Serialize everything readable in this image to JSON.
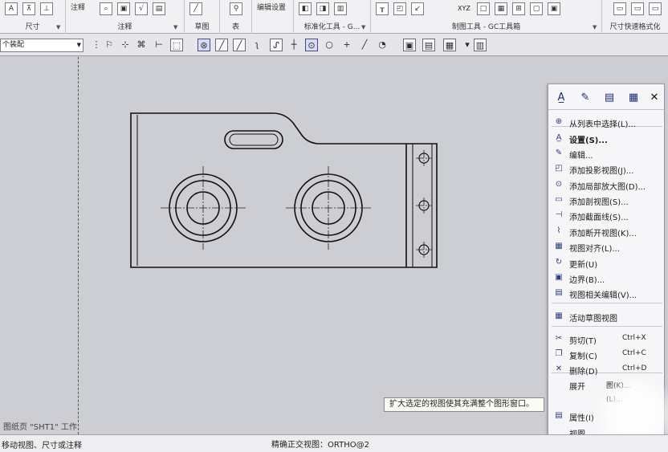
{
  "ribbon": {
    "groups": [
      {
        "top_label": "",
        "label": "尺寸"
      },
      {
        "top_label": "注释",
        "label": "注释"
      },
      {
        "top_label": "",
        "label": "草图"
      },
      {
        "top_label": "",
        "label": "表"
      },
      {
        "top_label": "编辑设置",
        "label": ""
      },
      {
        "top_label": "",
        "label": "标准化工具 - G..."
      },
      {
        "top_label": "",
        "label": "制图工具 - GC工具箱"
      },
      {
        "top_label": "",
        "label": "尺寸快速格式化"
      }
    ],
    "xyz_label": "XYZ"
  },
  "toolbar": {
    "filter_value": "个装配"
  },
  "canvas": {
    "sheet_label": "图纸页 \"SHT1\" 工作"
  },
  "context_menu": {
    "items": [
      {
        "icon": "list-select-icon",
        "label": "从列表中选择(L)...",
        "shortcut": ""
      },
      {
        "icon": "settings-icon",
        "label": "设置(S)...",
        "shortcut": "",
        "bold": true
      },
      {
        "icon": "edit-icon",
        "label": "编辑...",
        "shortcut": ""
      },
      {
        "icon": "projected-view-icon",
        "label": "添加投影视图(J)...",
        "shortcut": ""
      },
      {
        "icon": "detail-view-icon",
        "label": "添加局部放大图(D)...",
        "shortcut": ""
      },
      {
        "icon": "section-view-icon",
        "label": "添加剖视图(S)...",
        "shortcut": ""
      },
      {
        "icon": "section-line-icon",
        "label": "添加截面线(S)...",
        "shortcut": ""
      },
      {
        "icon": "break-view-icon",
        "label": "添加断开视图(K)...",
        "shortcut": ""
      },
      {
        "icon": "view-align-icon",
        "label": "视图对齐(L)...",
        "shortcut": ""
      },
      {
        "icon": "update-icon",
        "label": "更新(U)",
        "shortcut": ""
      },
      {
        "icon": "boundary-icon",
        "label": "边界(B)...",
        "shortcut": ""
      },
      {
        "icon": "view-dependent-edit-icon",
        "label": "视图相关编辑(V)...",
        "shortcut": ""
      },
      {
        "icon": "active-sketch-view-icon",
        "label": "活动草图视图",
        "shortcut": ""
      },
      {
        "icon": "cut-icon",
        "label": "剪切(T)",
        "shortcut": "Ctrl+X"
      },
      {
        "icon": "copy-icon",
        "label": "复制(C)",
        "shortcut": "Ctrl+C"
      },
      {
        "icon": "delete-icon",
        "label": "删除(D)",
        "shortcut": "Ctrl+D"
      },
      {
        "icon": "",
        "label": "展开",
        "shortcut": "图(K)..."
      },
      {
        "icon": "",
        "label": "",
        "shortcut": "(L)..."
      },
      {
        "icon": "properties-icon",
        "label": "属性(I)",
        "shortcut": ""
      },
      {
        "icon": "",
        "label": "视图",
        "shortcut": ""
      }
    ]
  },
  "tooltip": {
    "text": "扩大选定的视图使其充满整个图形窗口。"
  },
  "status_bar": {
    "left": "移动视图、尺寸或注释",
    "center": "精确正交视图：ORTHO@2"
  }
}
